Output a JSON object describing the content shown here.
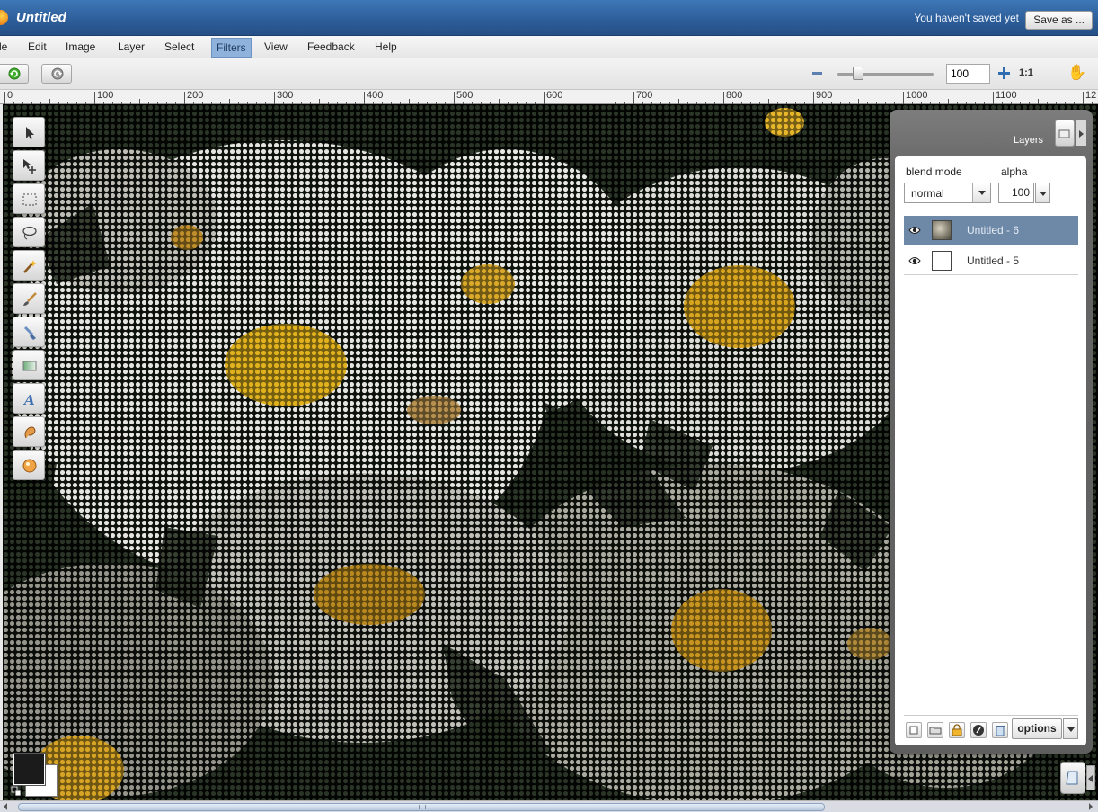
{
  "window": {
    "title": "Untitled",
    "save_status": "You haven't saved yet",
    "save_as_label": "Save as ..."
  },
  "menu": {
    "items": [
      "le",
      "Edit",
      "Image",
      "Layer",
      "Select",
      "Filters",
      "View",
      "Feedback",
      "Help"
    ],
    "active": "Filters"
  },
  "toolbar": {
    "undo_icon": "undo-icon",
    "redo_icon": "redo-icon",
    "zoom_value": "100",
    "zoom_ratio_label": "1:1",
    "zoom_slider_level": 0.18,
    "hand_icon": "hand-icon"
  },
  "ruler": {
    "labels": [
      "0",
      "100",
      "200",
      "300",
      "400",
      "500",
      "600",
      "700",
      "800",
      "900",
      "1000",
      "1100",
      "12"
    ]
  },
  "tools": [
    "move-tool-icon",
    "transform-tool-icon",
    "marquee-select-icon",
    "lasso-icon",
    "magic-wand-icon",
    "brush-icon",
    "clone-stamp-icon",
    "gradient-icon",
    "text-tool-icon",
    "smudge-icon",
    "color-picker-icon"
  ],
  "colors": {
    "foreground": "#1b1b1b",
    "background": "#ffffff",
    "title_bar": "#2c5d99",
    "selected_layer": "#6e88a8"
  },
  "layers_panel": {
    "title": "Layers",
    "blend_label": "blend mode",
    "blend_value": "normal",
    "alpha_label": "alpha",
    "alpha_value": "100",
    "layers": [
      {
        "name": "Untitled - 6",
        "visible": true,
        "selected": true
      },
      {
        "name": "Untitled - 5",
        "visible": true,
        "selected": false
      }
    ],
    "options_label": "options"
  }
}
